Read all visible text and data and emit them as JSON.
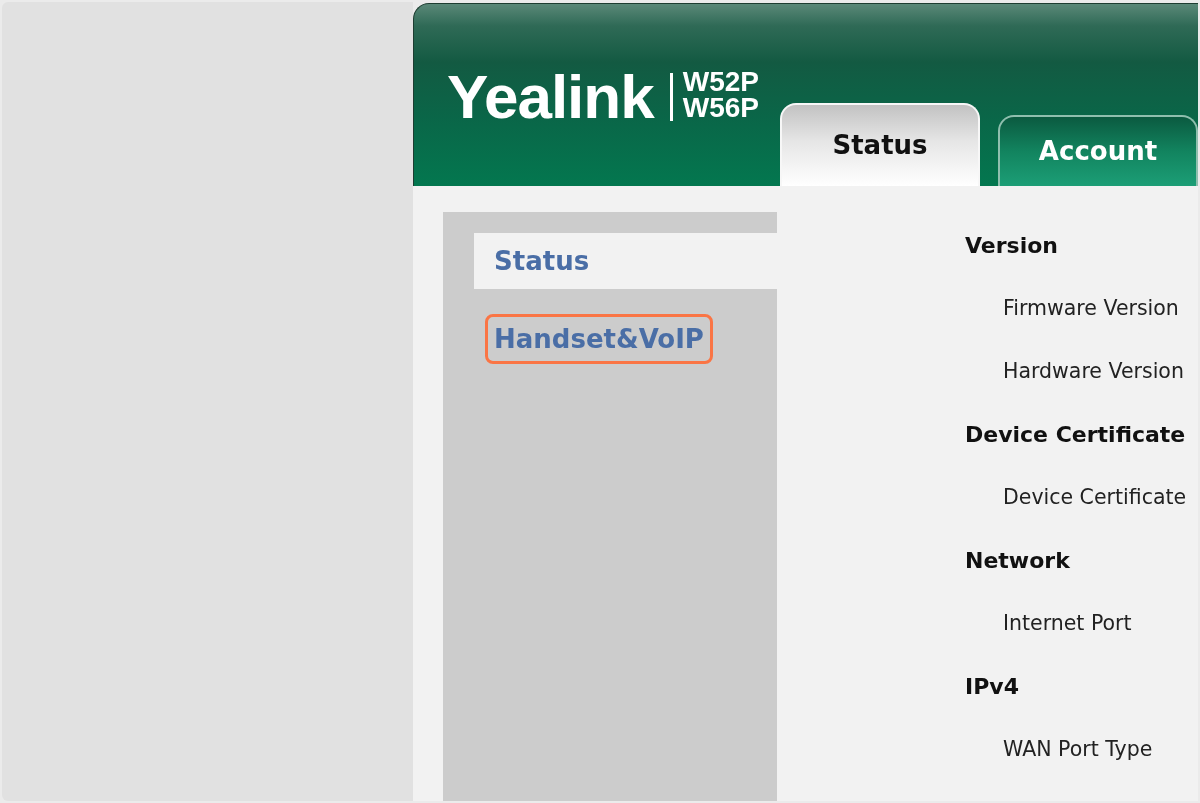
{
  "header": {
    "logo": "Yealink",
    "models": [
      "W52P",
      "W56P"
    ]
  },
  "tabs": [
    {
      "label": "Status",
      "selected": true
    },
    {
      "label": "Account",
      "selected": false
    }
  ],
  "sidebar": {
    "items": [
      {
        "label": "Status",
        "selected": true,
        "highlighted": false
      },
      {
        "label": "Handset&VoIP",
        "selected": false,
        "highlighted": true
      }
    ]
  },
  "sections": [
    {
      "title": "Version",
      "items": [
        "Firmware Version",
        "Hardware Version"
      ]
    },
    {
      "title": "Device Certificate",
      "items": [
        "Device Certificate"
      ]
    },
    {
      "title": "Network",
      "items": [
        "Internet Port"
      ]
    },
    {
      "title": "IPv4",
      "items": [
        "WAN Port Type"
      ]
    }
  ]
}
